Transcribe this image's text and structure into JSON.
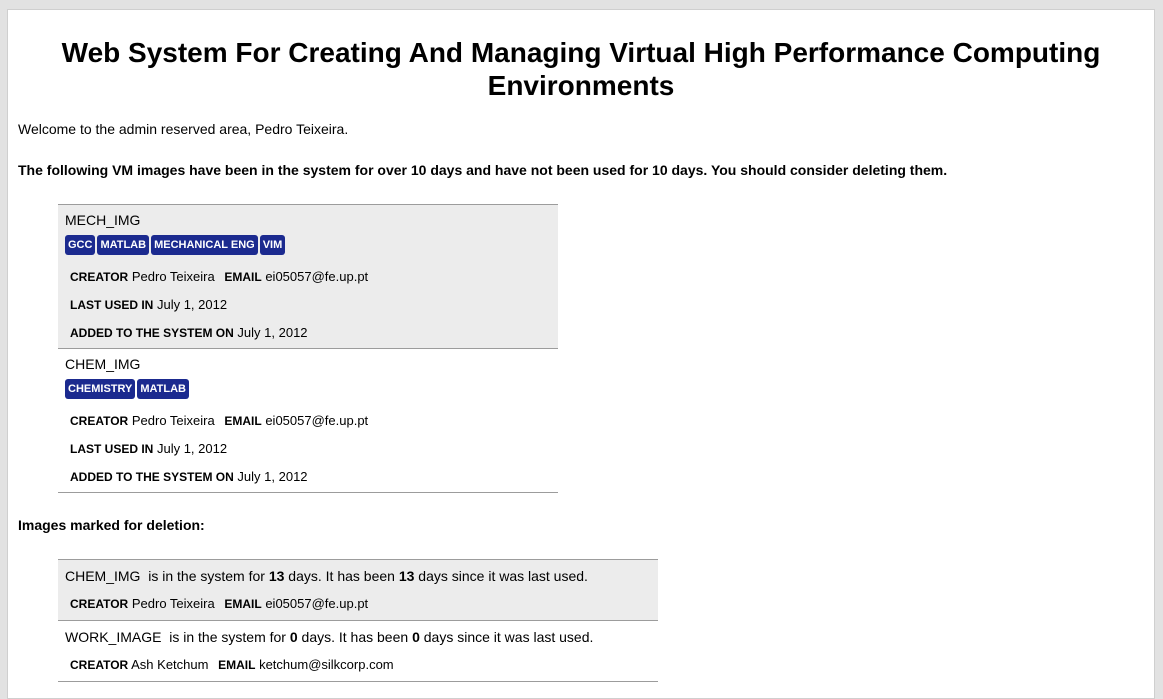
{
  "page_title": "Web System For Creating And Managing Virtual High Performance Computing Environments",
  "welcome": "Welcome to the admin reserved area, Pedro Teixeira.",
  "warning": "The following VM images have been in the system for over 10 days and have not been used for 10 days. You should consider deleting them.",
  "labels": {
    "creator": "CREATOR",
    "email": "EMAIL",
    "last_used": "LAST USED IN",
    "added": "ADDED TO THE SYSTEM ON"
  },
  "stale_images": [
    {
      "name": "MECH_IMG",
      "tags": [
        "GCC",
        "MATLAB",
        "MECHANICAL ENG",
        "VIM"
      ],
      "creator": "Pedro Teixeira",
      "email": "ei05057@fe.up.pt",
      "last_used": "July 1, 2012",
      "added": "July 1, 2012"
    },
    {
      "name": "CHEM_IMG",
      "tags": [
        "CHEMISTRY",
        "MATLAB"
      ],
      "creator": "Pedro Teixeira",
      "email": "ei05057@fe.up.pt",
      "last_used": "July 1, 2012",
      "added": "July 1, 2012"
    }
  ],
  "marked_heading": "Images marked for deletion:",
  "marked_text": {
    "in_system": "is in the system for",
    "days_mid": "days. It has been",
    "days_end": "days since it was last used."
  },
  "marked_images": [
    {
      "name": "CHEM_IMG",
      "days_in_system": "13",
      "days_unused": "13",
      "creator": "Pedro Teixeira",
      "email": "ei05057@fe.up.pt"
    },
    {
      "name": "WORK_IMAGE",
      "days_in_system": "0",
      "days_unused": "0",
      "creator": "Ash Ketchum",
      "email": "ketchum@silkcorp.com"
    }
  ]
}
